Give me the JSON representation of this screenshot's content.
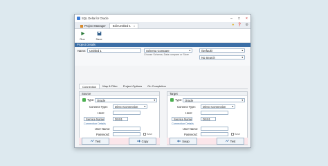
{
  "app": {
    "title": "SQL Delta for Oracle"
  },
  "tabs": [
    {
      "label": "Project Manager"
    },
    {
      "label": "Edit Untitled 1"
    }
  ],
  "toolbar": {
    "run_label": "Run",
    "save_label": "Save"
  },
  "project": {
    "header": "Project Details",
    "name_label": "Name:",
    "name_value": "Untitled 1",
    "compare_select": "Schema Compare",
    "compare_hint": "Choose Schema, Data compare or Store",
    "default_select": "(Default)",
    "nosearch_select": "No Search"
  },
  "subtabs": [
    {
      "label": "Connection"
    },
    {
      "label": "Map & Filter"
    },
    {
      "label": "Project Options"
    },
    {
      "label": "On Completion"
    }
  ],
  "source": {
    "header": "Source",
    "type_label": "Type:",
    "type_value": "Oracle",
    "conn_type_label": "Connect Type:",
    "conn_type_value": "Direct Connection",
    "host_label": "Host:",
    "service_select": "Service Name",
    "service_value": "DSS1",
    "conn_details": "Connection Details",
    "user_label": "User Name:",
    "password_label": "Password:",
    "save_label": "Save",
    "role_label": "Connect Role:",
    "role_value": "Default",
    "os_auth_label": "OS Authenticate",
    "test_label": "Test",
    "copy_label": "Copy"
  },
  "target": {
    "header": "Target",
    "type_label": "Type:",
    "type_value": "Oracle",
    "conn_type_label": "Connect Type:",
    "conn_type_value": "Direct Connection",
    "host_label": "Host:",
    "service_select": "Service Name",
    "service_value": "DSS1",
    "conn_details": "Connection Details",
    "user_label": "User Name:",
    "password_label": "Password:",
    "save_label": "Save",
    "role_label": "Connect Role:",
    "role_value": "Default",
    "os_auth_label": "OS Authenticate",
    "swap_label": "Swap",
    "test_label": "Test"
  },
  "colors": {
    "accent": "#3b6ea6",
    "source_db": "#4caf50",
    "target_db": "#4caf50"
  }
}
